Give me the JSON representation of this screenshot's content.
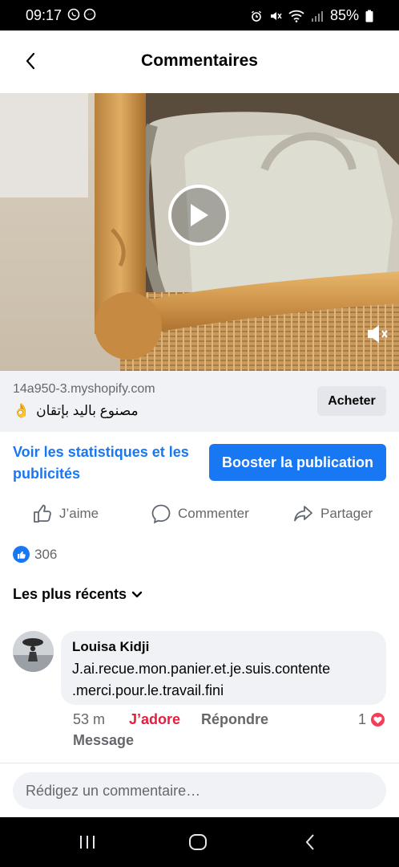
{
  "status_bar": {
    "time": "09:17",
    "battery": "85%",
    "left_icons": [
      "whatsapp-icon",
      "messenger-icon"
    ],
    "right_icons": [
      "alarm-icon",
      "mute-icon",
      "wifi-icon",
      "signal-icon",
      "battery-icon"
    ]
  },
  "header": {
    "title": "Commentaires",
    "back_icon": "chevron-left-icon"
  },
  "video": {
    "play_icon": "play-icon",
    "mute_icon": "speaker-muted-icon"
  },
  "link": {
    "domain": "14a950-3.myshopify.com",
    "title": "مصنوع باليد بإتقان",
    "emoji": "👌",
    "cta_label": "Acheter"
  },
  "promo": {
    "stats_label": "Voir les statistiques et les publicités",
    "boost_label": "Booster la publication"
  },
  "actions": {
    "like_label": "J’aime",
    "comment_label": "Commenter",
    "share_label": "Partager"
  },
  "reactions": {
    "count": "306"
  },
  "sort": {
    "label": "Les plus récents"
  },
  "comments": [
    {
      "author": "Louisa Kidji",
      "text": "J.ai.recue.mon.panier.et.je.suis.contente\n.merci.pour.le.travail.fini",
      "time": "53 m",
      "reaction_label": "J’adore",
      "reply_label": "Répondre",
      "message_label": "Message",
      "reaction_count": "1"
    }
  ],
  "composer": {
    "placeholder": "Rédigez un commentaire…"
  },
  "colors": {
    "accent": "#1877f2",
    "love": "#e41e3f",
    "secondary_text": "#65676b",
    "surface": "#f0f2f5"
  }
}
